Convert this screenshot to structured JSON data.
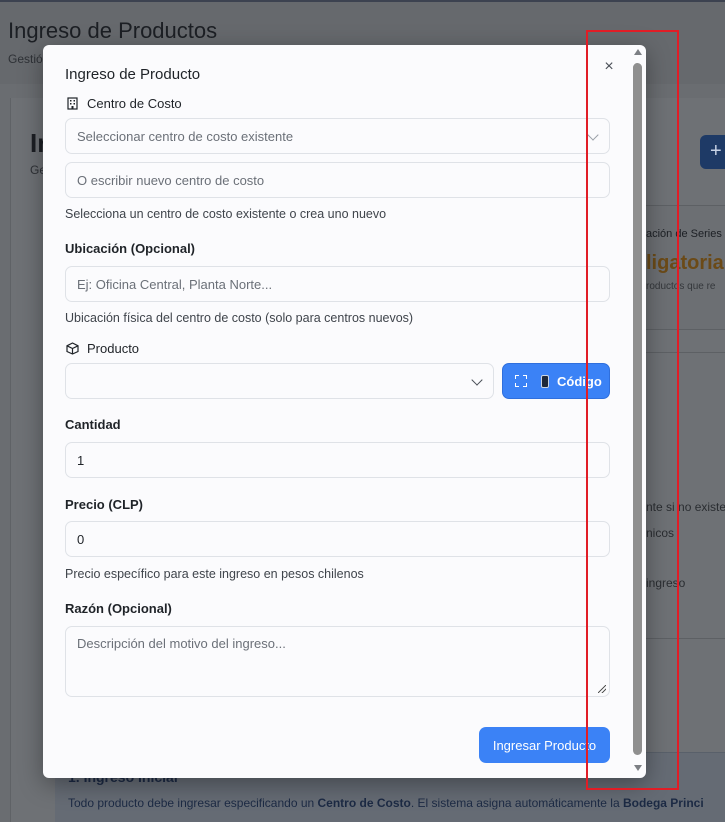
{
  "background": {
    "page_title": "Ingreso de Productos",
    "page_subtitle": "Gestió",
    "section_heading": "In",
    "section_subtitle": "Ge",
    "plus_button": "+",
    "panel": {
      "title": "ación de Series",
      "big_text": "ligatoria",
      "small_text": "roductos que re"
    },
    "list_items": [
      "nte si no existe",
      "nicos",
      "ingreso"
    ],
    "info_box": {
      "title": "1. Ingreso Inicial",
      "text_prefix": "Todo producto debe ingresar especificando un ",
      "text_bold1": "Centro de Costo",
      "text_middle": ". El sistema asigna automáticamente la ",
      "text_bold2": "Bodega Princi"
    }
  },
  "modal": {
    "title": "Ingreso de Producto",
    "close_label": "×",
    "cost_center": {
      "label": "Centro de Costo",
      "select_placeholder": "Seleccionar centro de costo existente",
      "input_placeholder": "O escribir nuevo centro de costo",
      "help": "Selecciona un centro de costo existente o crea uno nuevo"
    },
    "location": {
      "label": "Ubicación (Opcional)",
      "placeholder": "Ej: Oficina Central, Planta Norte...",
      "help": "Ubicación física del centro de costo (solo para centros nuevos)"
    },
    "product": {
      "label": "Producto",
      "select_value": "",
      "code_button": "Código"
    },
    "quantity": {
      "label": "Cantidad",
      "value": "1"
    },
    "price": {
      "label": "Precio (CLP)",
      "value": "0",
      "help": "Precio específico para este ingreso en pesos chilenos"
    },
    "reason": {
      "label": "Razón (Opcional)",
      "placeholder": "Descripción del motivo del ingreso..."
    },
    "submit_label": "Ingresar Producto"
  },
  "colors": {
    "primary": "#3b82f6",
    "annotation": "#e11d26",
    "overlay": "#6a6d71"
  }
}
